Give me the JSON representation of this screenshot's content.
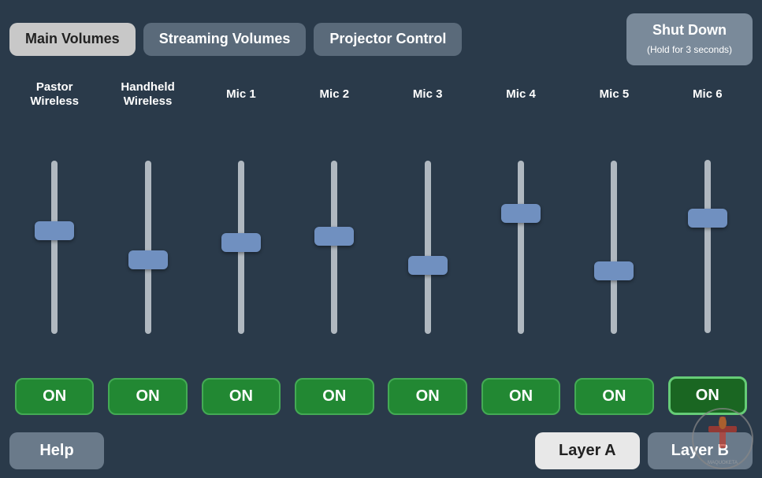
{
  "header": {
    "tabs": [
      {
        "id": "main-volumes",
        "label": "Main\nVolumes",
        "active": true
      },
      {
        "id": "streaming-volumes",
        "label": "Streaming\nVolumes",
        "active": false
      },
      {
        "id": "projector-control",
        "label": "Projector\nControl",
        "active": false
      }
    ],
    "shutdown": {
      "label": "Shut Down",
      "subtitle": "(Hold for 3 seconds)"
    }
  },
  "channels": [
    {
      "id": "pastor-wireless",
      "label": "Pastor\nWireless",
      "fader_top_pct": 35,
      "on": true,
      "outlined": false
    },
    {
      "id": "handheld-wireless",
      "label": "Handheld\nWireless",
      "fader_top_pct": 52,
      "on": true,
      "outlined": false
    },
    {
      "id": "mic1",
      "label": "Mic 1",
      "fader_top_pct": 42,
      "on": true,
      "outlined": false
    },
    {
      "id": "mic2",
      "label": "Mic 2",
      "fader_top_pct": 38,
      "on": true,
      "outlined": false
    },
    {
      "id": "mic3",
      "label": "Mic 3",
      "fader_top_pct": 55,
      "on": true,
      "outlined": false
    },
    {
      "id": "mic4",
      "label": "Mic 4",
      "fader_top_pct": 25,
      "on": true,
      "outlined": false
    },
    {
      "id": "mic5",
      "label": "Mic 5",
      "fader_top_pct": 58,
      "on": true,
      "outlined": false
    },
    {
      "id": "mic6",
      "label": "Mic 6",
      "fader_top_pct": 28,
      "on": true,
      "outlined": true
    }
  ],
  "footer": {
    "help_label": "Help",
    "layer_a_label": "Layer A",
    "layer_b_label": "Layer B",
    "layer_a_active": true,
    "layer_b_active": false
  },
  "colors": {
    "bg": "#2a3a4a",
    "tab_active": "#c8c8c8",
    "tab_inactive": "#5a6a7a",
    "fader_handle": "#7090c0",
    "fader_track": "#b0b8c0",
    "on_green": "#228833",
    "on_border": "#44aa55"
  }
}
